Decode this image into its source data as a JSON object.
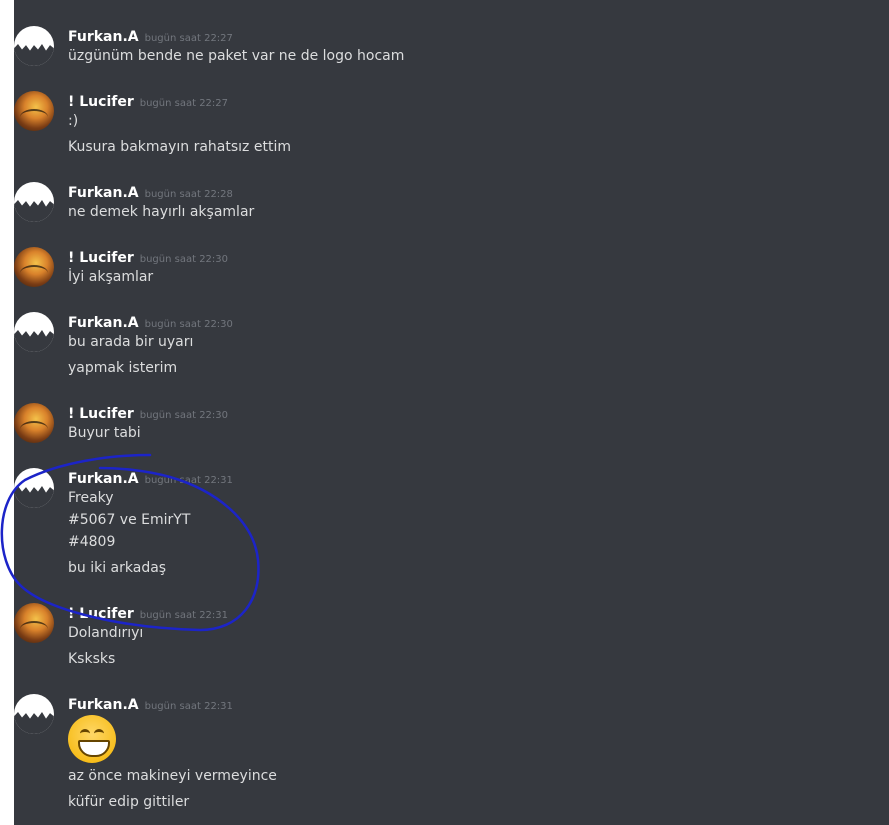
{
  "messages": [
    {
      "user": "Furkan.A",
      "time": "bugün saat 22:27",
      "lines": [
        "üzgünüm bende ne paket var ne de logo hocam"
      ]
    },
    {
      "user": "! Lucifer",
      "time": "bugün saat 22:27",
      "lines": [
        ":)",
        "Kusura bakmayın rahatsız ettim"
      ]
    },
    {
      "user": "Furkan.A",
      "time": "bugün saat 22:28",
      "lines": [
        "ne demek hayırlı akşamlar"
      ]
    },
    {
      "user": "! Lucifer",
      "time": "bugün saat 22:30",
      "lines": [
        "İyi akşamlar"
      ]
    },
    {
      "user": "Furkan.A",
      "time": "bugün saat 22:30",
      "lines": [
        "bu arada bir uyarı",
        "yapmak isterim"
      ]
    },
    {
      "user": "! Lucifer",
      "time": "bugün saat 22:30",
      "lines": [
        "Buyur tabi"
      ]
    },
    {
      "user": "Furkan.A",
      "time": "bugün saat 22:31",
      "lines": [
        "Freaky",
        "#5067 ve EmirYT",
        "#4809",
        "bu iki arkadaş"
      ]
    },
    {
      "user": "! Lucifer",
      "time": "bugün saat 22:31",
      "lines": [
        "Dolandırıyı",
        "Ksksks"
      ]
    },
    {
      "user": "Furkan.A",
      "time": "bugün saat 22:31",
      "emoji": "grinning-face-emoji",
      "lines": [
        "az önce makineyi vermeyince",
        "küfür edip gittiler"
      ]
    }
  ]
}
